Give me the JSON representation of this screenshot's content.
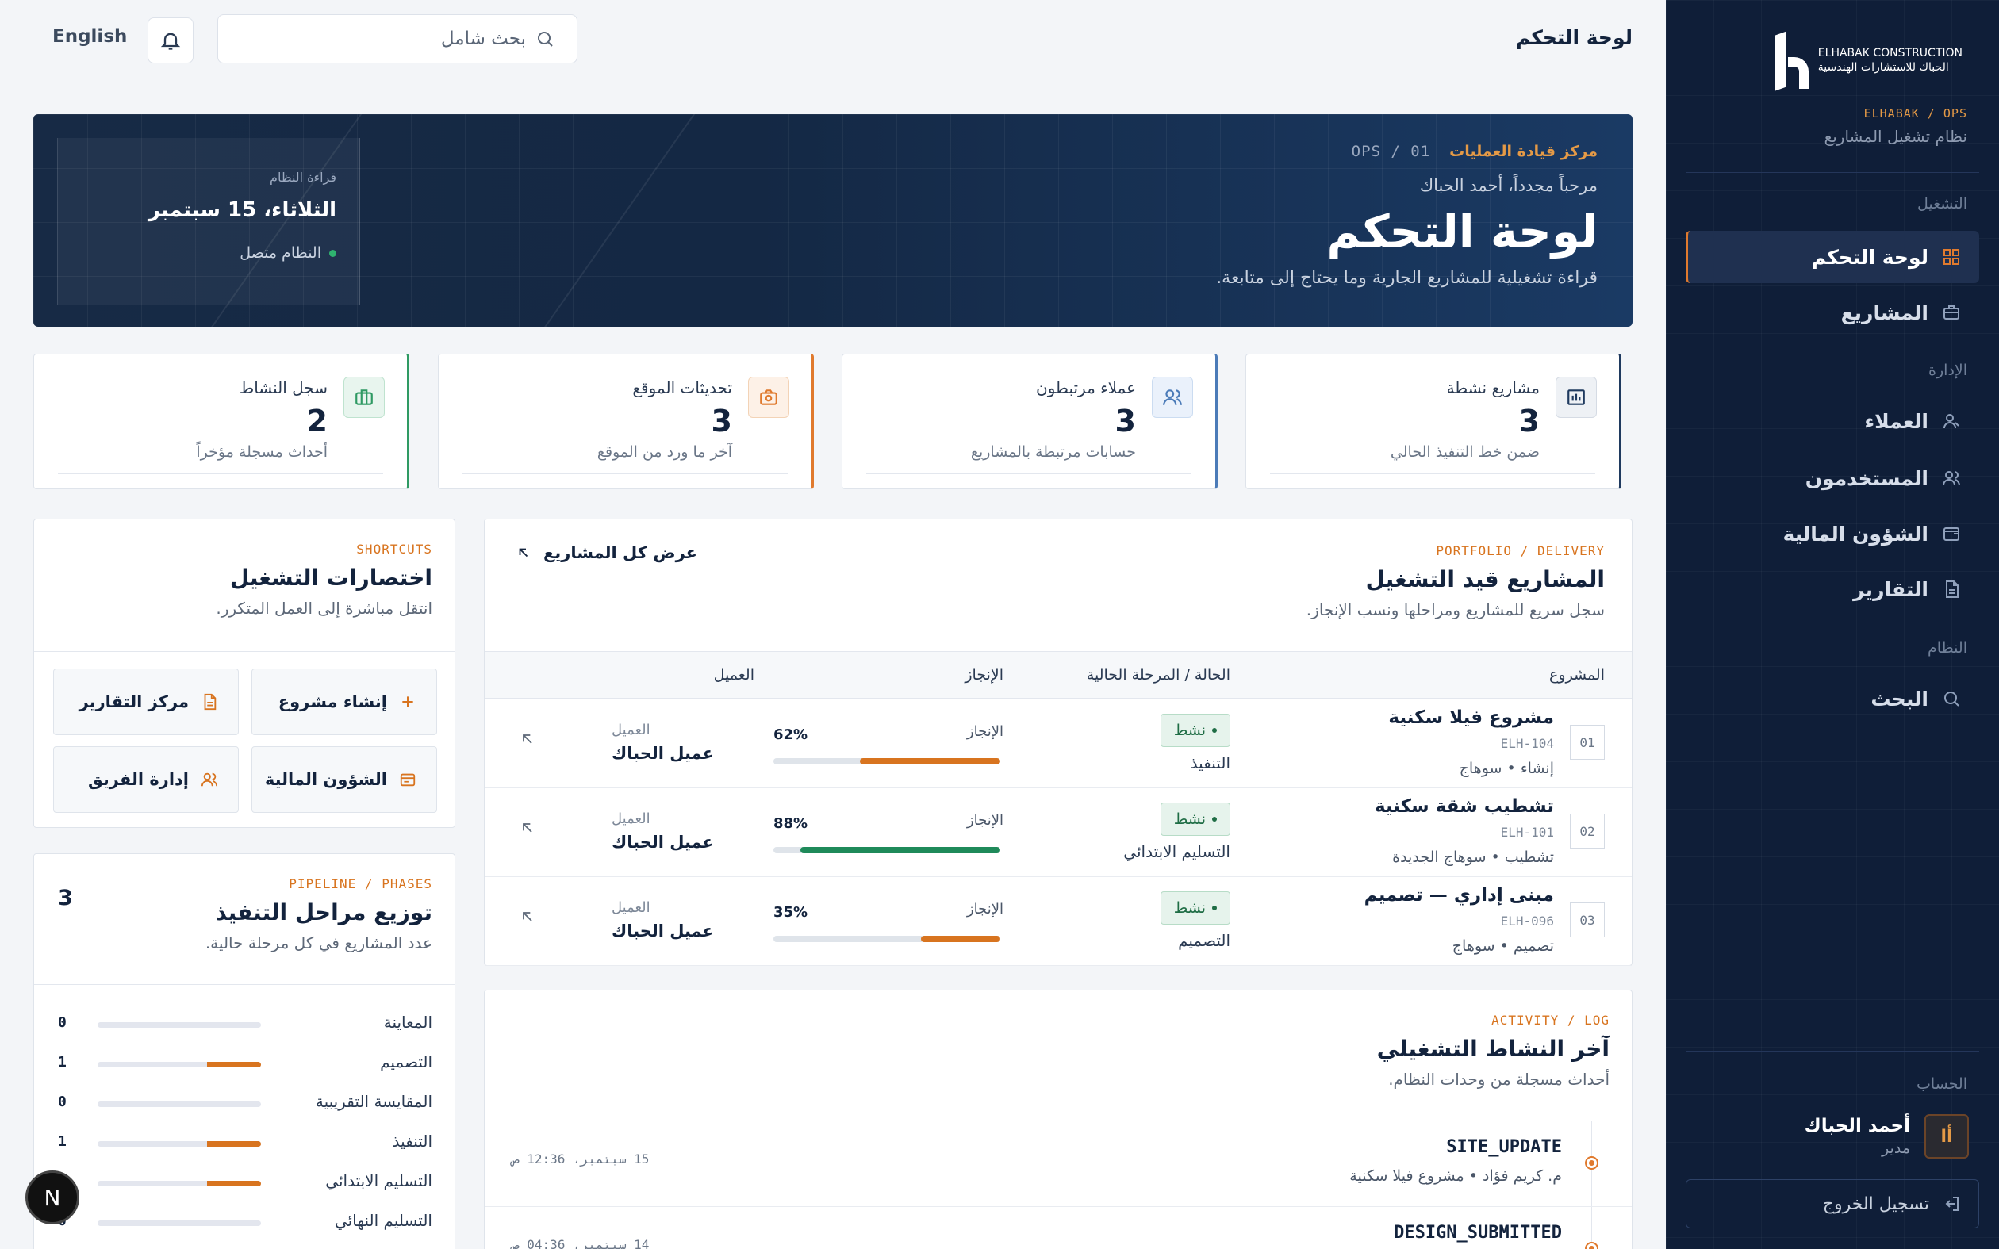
{
  "sidebar": {
    "brand_en": "ELHABAK CONSTRUCTION",
    "brand_ar": "الحباك للاستشارات الهندسية",
    "code": "ELHABAK / OPS",
    "system_name": "نظام تشغيل المشاريع",
    "groups": {
      "ops": "التشغيل",
      "admin": "الإدارة",
      "system": "النظام",
      "account": "الحساب"
    },
    "items": [
      {
        "label": "لوحة التحكم",
        "icon": "grid-icon"
      },
      {
        "label": "المشاريع",
        "icon": "briefcase-icon"
      },
      {
        "label": "العملاء",
        "icon": "user-icon"
      },
      {
        "label": "المستخدمون",
        "icon": "users-icon"
      },
      {
        "label": "الشؤون المالية",
        "icon": "wallet-icon"
      },
      {
        "label": "التقارير",
        "icon": "document-icon"
      },
      {
        "label": "البحث",
        "icon": "search-icon"
      }
    ],
    "user": {
      "initial": "أا",
      "name": "أحمد الحباك",
      "role": "مدير"
    },
    "logout": "تسجيل الخروج"
  },
  "topbar": {
    "title": "لوحة التحكم",
    "search_placeholder": "بحث شامل",
    "language": "English"
  },
  "hero": {
    "tag": "مركز قيادة العمليات",
    "code": "OPS / 01",
    "greeting": "مرحباً مجدداً، أحمد الحباك",
    "title": "لوحة التحكم",
    "description": "قراءة تشغيلية للمشاريع الجارية وما يحتاج إلى متابعة.",
    "reading_label": "قراءة النظام",
    "date": "الثلاثاء، 15 سبتمبر",
    "status": "النظام متصل"
  },
  "stats": [
    {
      "label": "مشاريع نشطة",
      "value": "3",
      "sub": "ضمن خط التنفيذ الحالي",
      "accent": "#1f3a5f"
    },
    {
      "label": "عملاء مرتبطون",
      "value": "3",
      "sub": "حسابات مرتبطة بالمشاريع",
      "accent": "#4b7bb8"
    },
    {
      "label": "تحديثات الموقع",
      "value": "3",
      "sub": "آخر ما ورد من الموقع",
      "accent": "#e07a2e"
    },
    {
      "label": "سجل النشاط",
      "value": "2",
      "sub": "أحداث مسجلة مؤخراً",
      "accent": "#2f9a63"
    }
  ],
  "projects": {
    "tag": "PORTFOLIO / DELIVERY",
    "title": "المشاريع قيد التشغيل",
    "subtitle": "سجل سريع للمشاريع ومراحلها ونسب الإنجاز.",
    "view_all": "عرض كل المشاريع",
    "columns": {
      "project": "المشروع",
      "status": "الحالة / المرحلة الحالية",
      "progress": "الإنجاز",
      "client": "العميل"
    },
    "rows": [
      {
        "num": "01",
        "name": "مشروع فيلا سكنية",
        "code": "ELH-104",
        "location": "إنشاء • سوهاج",
        "status": "نشط",
        "phase": "التنفيذ",
        "progress_label": "الإنجاز",
        "progress": 62,
        "progress_text": "62%",
        "client_label": "العميل",
        "client": "عميل الحباك",
        "color": "#d8741f"
      },
      {
        "num": "02",
        "name": "تشطيب شقة سكنية",
        "code": "ELH-101",
        "location": "تشطيب • سوهاج الجديدة",
        "status": "نشط",
        "phase": "التسليم الابتدائي",
        "progress_label": "الإنجاز",
        "progress": 88,
        "progress_text": "88%",
        "client_label": "العميل",
        "client": "عميل الحباك",
        "color": "#1f8a5a"
      },
      {
        "num": "03",
        "name": "مبنى إداري — تصميم",
        "code": "ELH-096",
        "location": "تصميم • سوهاج",
        "status": "نشط",
        "phase": "التصميم",
        "progress_label": "الإنجاز",
        "progress": 35,
        "progress_text": "35%",
        "client_label": "العميل",
        "client": "عميل الحباك",
        "color": "#d8741f"
      }
    ]
  },
  "shortcuts": {
    "tag": "SHORTCUTS",
    "title": "اختصارات التشغيل",
    "subtitle": "انتقل مباشرة إلى العمل المتكرر.",
    "items": [
      {
        "label": "إنشاء مشروع",
        "icon": "plus-icon"
      },
      {
        "label": "مركز التقارير",
        "icon": "document-icon"
      },
      {
        "label": "الشؤون المالية",
        "icon": "wallet-icon"
      },
      {
        "label": "إدارة الفريق",
        "icon": "users-icon"
      }
    ]
  },
  "phases": {
    "tag": "PIPELINE / PHASES",
    "title": "توزيع مراحل التنفيذ",
    "subtitle": "عدد المشاريع في كل مرحلة حالية.",
    "count": "3",
    "items": [
      {
        "name": "المعاينة",
        "value": "0",
        "fraction": 0
      },
      {
        "name": "التصميم",
        "value": "1",
        "fraction": 0.33
      },
      {
        "name": "المقايسة التقريبية",
        "value": "0",
        "fraction": 0
      },
      {
        "name": "التنفيذ",
        "value": "1",
        "fraction": 0.33
      },
      {
        "name": "التسليم الابتدائي",
        "value": "1",
        "fraction": 0.33
      },
      {
        "name": "التسليم النهائي",
        "value": "0",
        "fraction": 0
      }
    ]
  },
  "activity": {
    "tag": "ACTIVITY / LOG",
    "title": "آخر النشاط التشغيلي",
    "subtitle": "أحداث مسجلة من وحدات النظام.",
    "items": [
      {
        "event": "SITE_UPDATE",
        "detail": "م. كريم فؤاد • مشروع فيلا سكنية",
        "time": "15 سبتمبر، 12:36 ص"
      },
      {
        "event": "DESIGN_SUBMITTED",
        "detail": "",
        "time": "14 سبتمبر، 04:36 ص"
      }
    ]
  },
  "fab": {
    "label": "N"
  }
}
